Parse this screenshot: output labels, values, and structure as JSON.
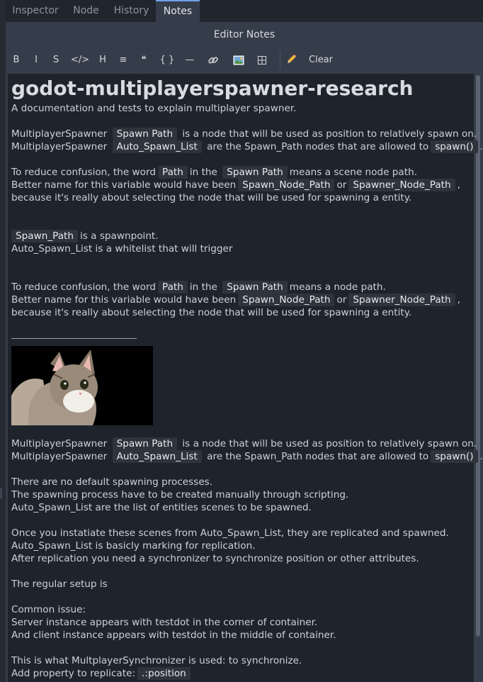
{
  "tabs": [
    "Inspector",
    "Node",
    "History",
    "Notes"
  ],
  "panel_title": "Editor Notes",
  "toolbar": {
    "bold": "B",
    "italic": "I",
    "strike": "S",
    "code_inline": "</>",
    "heading": "H",
    "list": "≡",
    "quote": "❝",
    "code_block": "{ }",
    "divider": "—",
    "clear": "Clear"
  },
  "doc": {
    "heading": "godot-multiplayerspawner-research",
    "subtitle": "A documentation and tests to explain multiplayer spawner.",
    "p1a": {
      "pre": "MultiplayerSpawner",
      "code": "Spawn Path",
      "post": "is a node that will be used as position to relatively spawn on."
    },
    "p1b": {
      "pre": "MultiplayerSpawner",
      "code": "Auto_Spawn_List",
      "mid": "are the Spawn_Path nodes that are allowed to",
      "code2": "spawn()",
      "post": "."
    },
    "p2a": {
      "pre": "To reduce confusion, the word",
      "code": "Path",
      "mid": "in the",
      "code2": "Spawn Path",
      "post": "means a scene node path."
    },
    "p2b": {
      "pre": "Better name for this variable would have been",
      "code": "Spawn_Node_Path",
      "mid": "or",
      "code2": "Spawner_Node_Path",
      "post": ","
    },
    "p2c": "because it's really about selecting the node that will be used for spawning a entity.",
    "p3a": {
      "code": "Spawn_Path",
      "post": "is a spawnpoint."
    },
    "p3b": "Auto_Spawn_List  is a whitelist that will trigger",
    "p4a": {
      "pre": "To reduce confusion, the word",
      "code": "Path",
      "mid": "in the",
      "code2": "Spawn Path",
      "post": "means a node path."
    },
    "p4b": {
      "pre": "Better name for this variable would have been",
      "code": "Spawn_Node_Path",
      "mid": "or",
      "code2": "Spawner_Node_Path",
      "post": ","
    },
    "p4c": "because it's really about selecting the node that will be used for spawning a entity.",
    "p5a": {
      "pre": "MultiplayerSpawner",
      "code": "Spawn Path",
      "post": "is a node that will be used as position to relatively spawn on."
    },
    "p5b": {
      "pre": "MultiplayerSpawner",
      "code": "Auto_Spawn_List",
      "mid": "are the Spawn_Path nodes that are allowed to",
      "code2": "spawn()",
      "post": "."
    },
    "p6a": "There are no default spawning processes.",
    "p6b": "The spawning process have to be created manually through scripting.",
    "p6c": "Auto_Spawn_List are the list of entities scenes to be spawned.",
    "p7a": "Once you instatiate these scenes from Auto_Spawn_List, they are replicated and spawned.",
    "p7b": "Auto_Spawn_List is basicly marking for replication.",
    "p7c": "After replication you need a synchronizer to synchronize position or other attributes.",
    "p8": "The regular setup is",
    "p9a": "Common issue:",
    "p9b": "Server instance appears with testdot in the corner of container.",
    "p9c": "And client instance appears with testdot  in the middle of container.",
    "p10a": "This is what MultplayerSynchronizer is used: to synchronize.",
    "p10b": {
      "pre": "Add property to replicate:",
      "code": ".:position"
    }
  },
  "colors": {
    "accent": "#6ea2e8",
    "editor_bg": "#1f242c",
    "panel_bg": "#363d4a"
  }
}
